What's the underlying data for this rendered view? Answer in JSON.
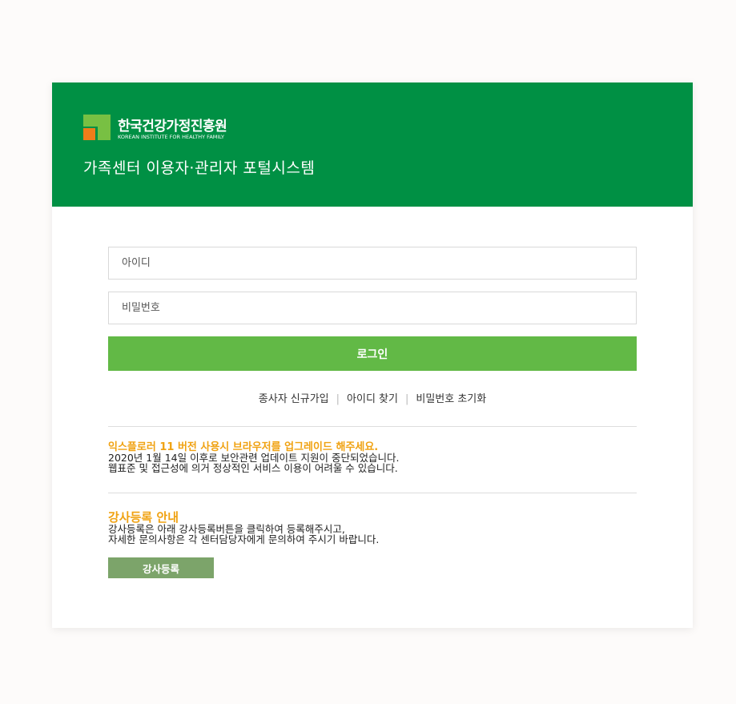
{
  "header": {
    "org_name": "한국건강가정진흥원",
    "org_name_eng": "KOREAN INSTITUTE FOR HEALTHY FAMILY",
    "portal_title": "가족센터 이용자·관리자 포털시스템",
    "logo_icon": "kihf-logo-icon",
    "colors": {
      "header_bg": "#009044",
      "logo_green": "#78c043",
      "logo_orange": "#ef7d1a"
    }
  },
  "login": {
    "id_placeholder": "아이디",
    "pw_placeholder": "비밀번호",
    "login_label": "로그인",
    "button_color": "#62b946"
  },
  "links": {
    "signup": "종사자 신규가입",
    "find_id": "아이디 찾기",
    "reset_pw": "비밀번호 초기화",
    "separator": "|"
  },
  "notice_ie": {
    "title": "익스플로러 11 버전 사용시 브라우저를 업그레이드 해주세요.",
    "line1": "2020년 1월 14일 이후로 보안관련 업데이트 지원이 중단되었습니다.",
    "line2": "웹표준 및 접근성에 의거 정상적인 서비스 이용이 어려울 수 있습니다."
  },
  "notice_instructor": {
    "title": "강사등록 안내",
    "line1": "강사등록은 아래 강사등록버튼을 클릭하여 등록해주시고,",
    "line2": "자세한 문의사항은 각 센터담당자에게 문의하여 주시기 바랍니다.",
    "button_label": "강사등록",
    "title_color": "#f0a212"
  }
}
